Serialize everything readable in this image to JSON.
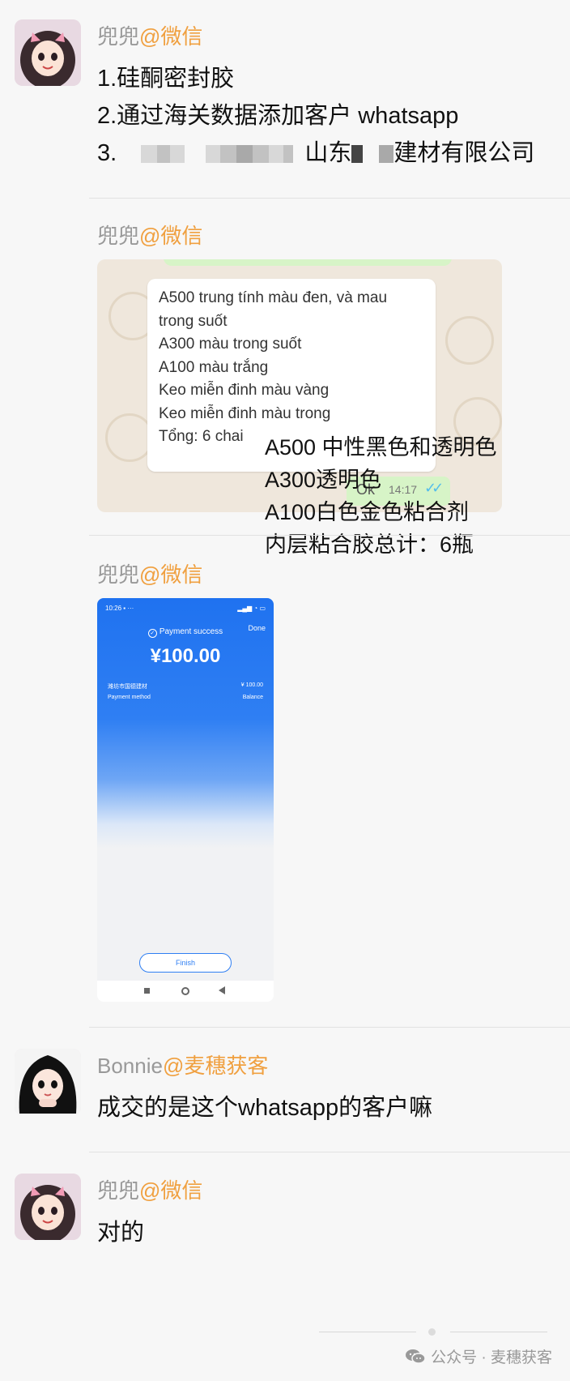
{
  "messages": [
    {
      "sender": "兜兜",
      "source": "@微信",
      "lines": [
        "1.硅酮密封胶",
        "2.通过海关数据添加客户 whatsapp"
      ],
      "line3_prefix": "3.",
      "line3_a": "山东",
      "line3_b": "建材有限公司"
    },
    {
      "sender": "兜兜",
      "source": "@微信",
      "whatsapp": {
        "lines": [
          "A500 trung tính màu đen, và mau",
          "trong suốt",
          "A300 màu trong suốt",
          "A100 màu trắng",
          "Keo miễn đinh màu vàng",
          "Keo miễn đinh màu trong",
          "Tổng: 6 chai"
        ],
        "ok": "Ok",
        "time": "14:17"
      },
      "translation": [
        "A500 中性黑色和透明色",
        "A300透明色",
        "A100白色金色粘合剂",
        "内层粘合胶总计：6瓶"
      ]
    },
    {
      "sender": "兜兜",
      "source": "@微信",
      "payment": {
        "status_time": "10:26",
        "done": "Done",
        "success": "Payment success",
        "amount": "¥100.00",
        "merchant": "潍坊市国德建材",
        "merchant_amount": "¥ 100.00",
        "method_label": "Payment method",
        "method_value": "Balance",
        "finish": "Finish"
      }
    },
    {
      "sender": "Bonnie",
      "source": "@麦穗获客",
      "text": "成交的是这个whatsapp的客户嘛"
    },
    {
      "sender": "兜兜",
      "source": "@微信",
      "text": "对的"
    }
  ],
  "footer": {
    "label": "公众号 · 麦穗获客"
  },
  "colors": {
    "source": "#f0a040",
    "sender": "#999999",
    "accent_blue": "#2f7ff3"
  }
}
